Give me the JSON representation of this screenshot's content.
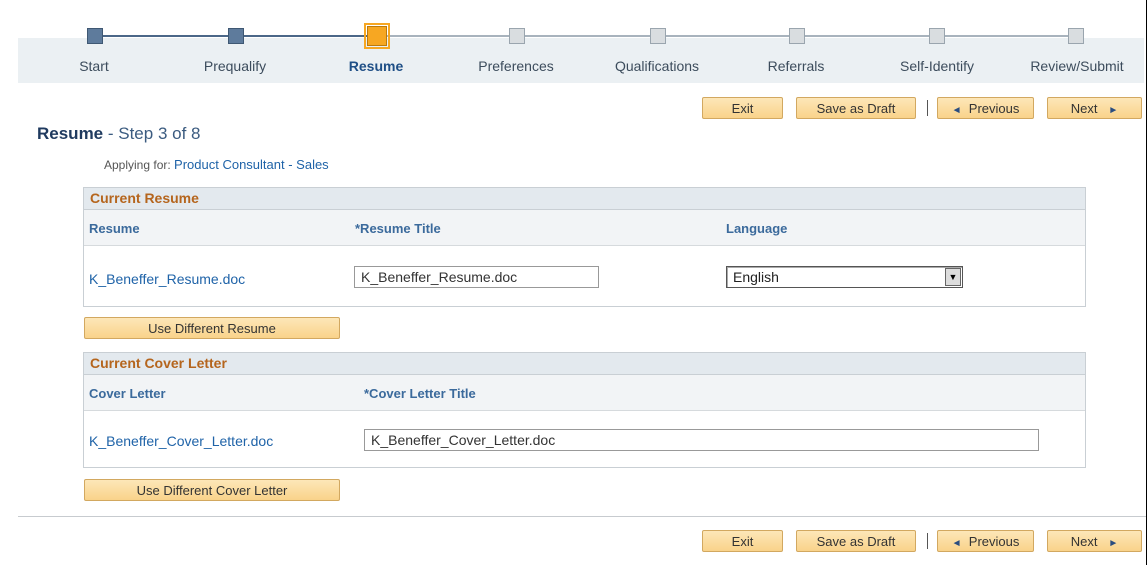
{
  "steps": [
    {
      "label": "Start",
      "state": "done"
    },
    {
      "label": "Prequalify",
      "state": "done"
    },
    {
      "label": "Resume",
      "state": "current"
    },
    {
      "label": "Preferences",
      "state": "todo"
    },
    {
      "label": "Qualifications",
      "state": "todo"
    },
    {
      "label": "Referrals",
      "state": "todo"
    },
    {
      "label": "Self-Identify",
      "state": "todo"
    },
    {
      "label": "Review/Submit",
      "state": "todo"
    }
  ],
  "toolbar": {
    "exit": "Exit",
    "save_draft": "Save as Draft",
    "previous": "Previous",
    "next": "Next",
    "previous_icon": "◄",
    "next_icon": "►"
  },
  "page": {
    "title": "Resume",
    "step_text": " - Step 3 of 8",
    "applying_label": "Applying for: ",
    "job_title": "Product Consultant - Sales"
  },
  "resume_group": {
    "title": "Current Resume",
    "col_resume": "Resume",
    "col_title": "*Resume Title",
    "col_language": "Language",
    "file_link": "K_Beneffer_Resume.doc",
    "title_value": "K_Beneffer_Resume.doc",
    "language_value": "English",
    "button": "Use Different Resume"
  },
  "cover_group": {
    "title": "Current Cover Letter",
    "col_cover": "Cover Letter",
    "col_title": "*Cover Letter Title",
    "file_link": "K_Beneffer_Cover_Letter.doc",
    "title_value": "K_Beneffer_Cover_Letter.doc",
    "button": "Use Different Cover Letter"
  },
  "colors": {
    "step_done": "#5e7b9c",
    "step_current": "#f7a722",
    "group_title": "#b5651d",
    "link": "#1f63a8"
  }
}
